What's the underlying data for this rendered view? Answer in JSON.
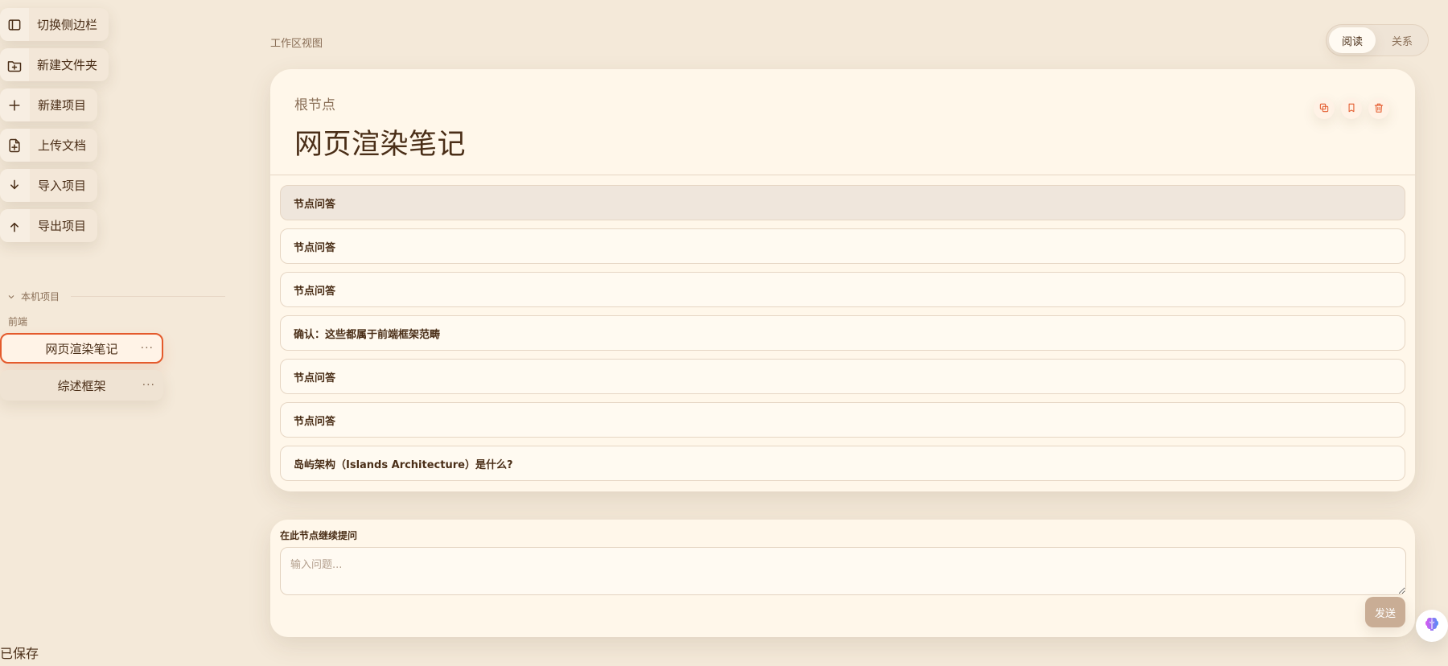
{
  "sidebar": {
    "actions": [
      {
        "name": "toggle-sidebar",
        "label": "切换侧边栏",
        "icon": "panel-icon"
      },
      {
        "name": "new-folder",
        "label": "新建文件夹",
        "icon": "folder-plus-icon"
      },
      {
        "name": "new-project",
        "label": "新建项目",
        "icon": "plus-icon"
      },
      {
        "name": "upload-doc",
        "label": "上传文档",
        "icon": "file-plus-icon"
      },
      {
        "name": "import-project",
        "label": "导入项目",
        "icon": "download-icon"
      },
      {
        "name": "export-project",
        "label": "导出项目",
        "icon": "upload-icon"
      }
    ],
    "section_title": "本机项目",
    "group_label": "前端",
    "projects": [
      {
        "label": "网页渲染笔记",
        "more": "···",
        "active": true
      },
      {
        "label": "综述框架",
        "more": "···",
        "active": false
      }
    ],
    "saved_text": "已保存"
  },
  "main": {
    "workspace_label": "工作区视图",
    "mode_toggle": {
      "read": "阅读",
      "relation": "关系",
      "active": "read"
    },
    "header": {
      "root_label": "根节点",
      "title": "网页渲染笔记"
    },
    "header_actions": [
      "copy-icon",
      "bookmark-icon",
      "trash-icon"
    ],
    "items": [
      {
        "text": "节点问答",
        "selected": true
      },
      {
        "text": "节点问答",
        "selected": false
      },
      {
        "text": "节点问答",
        "selected": false
      },
      {
        "text": "确认：这些都属于前端框架范畴",
        "selected": false
      },
      {
        "text": "节点问答",
        "selected": false
      },
      {
        "text": "节点问答",
        "selected": false
      },
      {
        "text": "岛屿架构（Islands Architecture）是什么?",
        "selected": false
      }
    ],
    "ask": {
      "title": "在此节点继续提问",
      "placeholder": "输入问题...",
      "send": "发送"
    }
  }
}
